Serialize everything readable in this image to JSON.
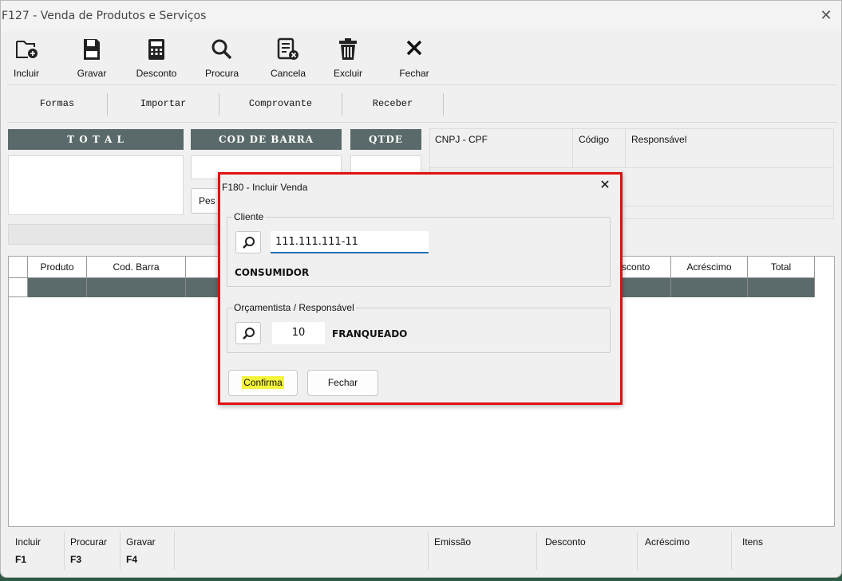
{
  "window": {
    "title": "F127 - Venda de Produtos e Serviços",
    "close_glyph": "✕"
  },
  "toolbar": [
    {
      "label": "Incluir",
      "icon": "folder-plus-icon"
    },
    {
      "label": "Gravar",
      "icon": "save-icon"
    },
    {
      "label": "Desconto",
      "icon": "calculator-icon"
    },
    {
      "label": "Procura",
      "icon": "search-icon"
    },
    {
      "label": "Cancela",
      "icon": "cancel-doc-icon"
    },
    {
      "label": "Excluir",
      "icon": "trash-icon"
    },
    {
      "label": "Fechar",
      "icon": "close-icon"
    }
  ],
  "tabs": [
    "Formas",
    "Importar",
    "Comprovante",
    "Receber"
  ],
  "panels": {
    "total_header": "T O T A L",
    "barcode_header": "COD DE BARRA",
    "qty_header": "QTDE",
    "search_btn": "Pes"
  },
  "info": {
    "cnpj_label": "CNPJ - CPF",
    "codigo_label": "Código",
    "responsavel_label": "Responsável"
  },
  "grid": {
    "columns": [
      "Produto",
      "Cod. Barra",
      "sconto",
      "Acréscimo",
      "Total"
    ]
  },
  "footer": {
    "keys": [
      {
        "label": "Incluir",
        "key": "F1"
      },
      {
        "label": "Procurar",
        "key": "F3"
      },
      {
        "label": "Gravar",
        "key": "F4"
      }
    ],
    "emissao_label": "Emissão",
    "desconto_label": "Desconto",
    "acrescimo_label": "Acréscimo",
    "itens_label": "Itens"
  },
  "dialog": {
    "title": "F180 - Incluir Venda",
    "close_glyph": "✕",
    "cliente_legend": "Cliente",
    "cliente_value": "111.111.111-11",
    "cliente_name": "CONSUMIDOR",
    "orc_legend": "Orçamentista / Responsável",
    "orc_code": "10",
    "orc_name": "FRANQUEADO",
    "confirm_label": "Confirma",
    "close_label": "Fechar",
    "highlight_color": "#f5f53c",
    "border_color": "#e01010"
  }
}
